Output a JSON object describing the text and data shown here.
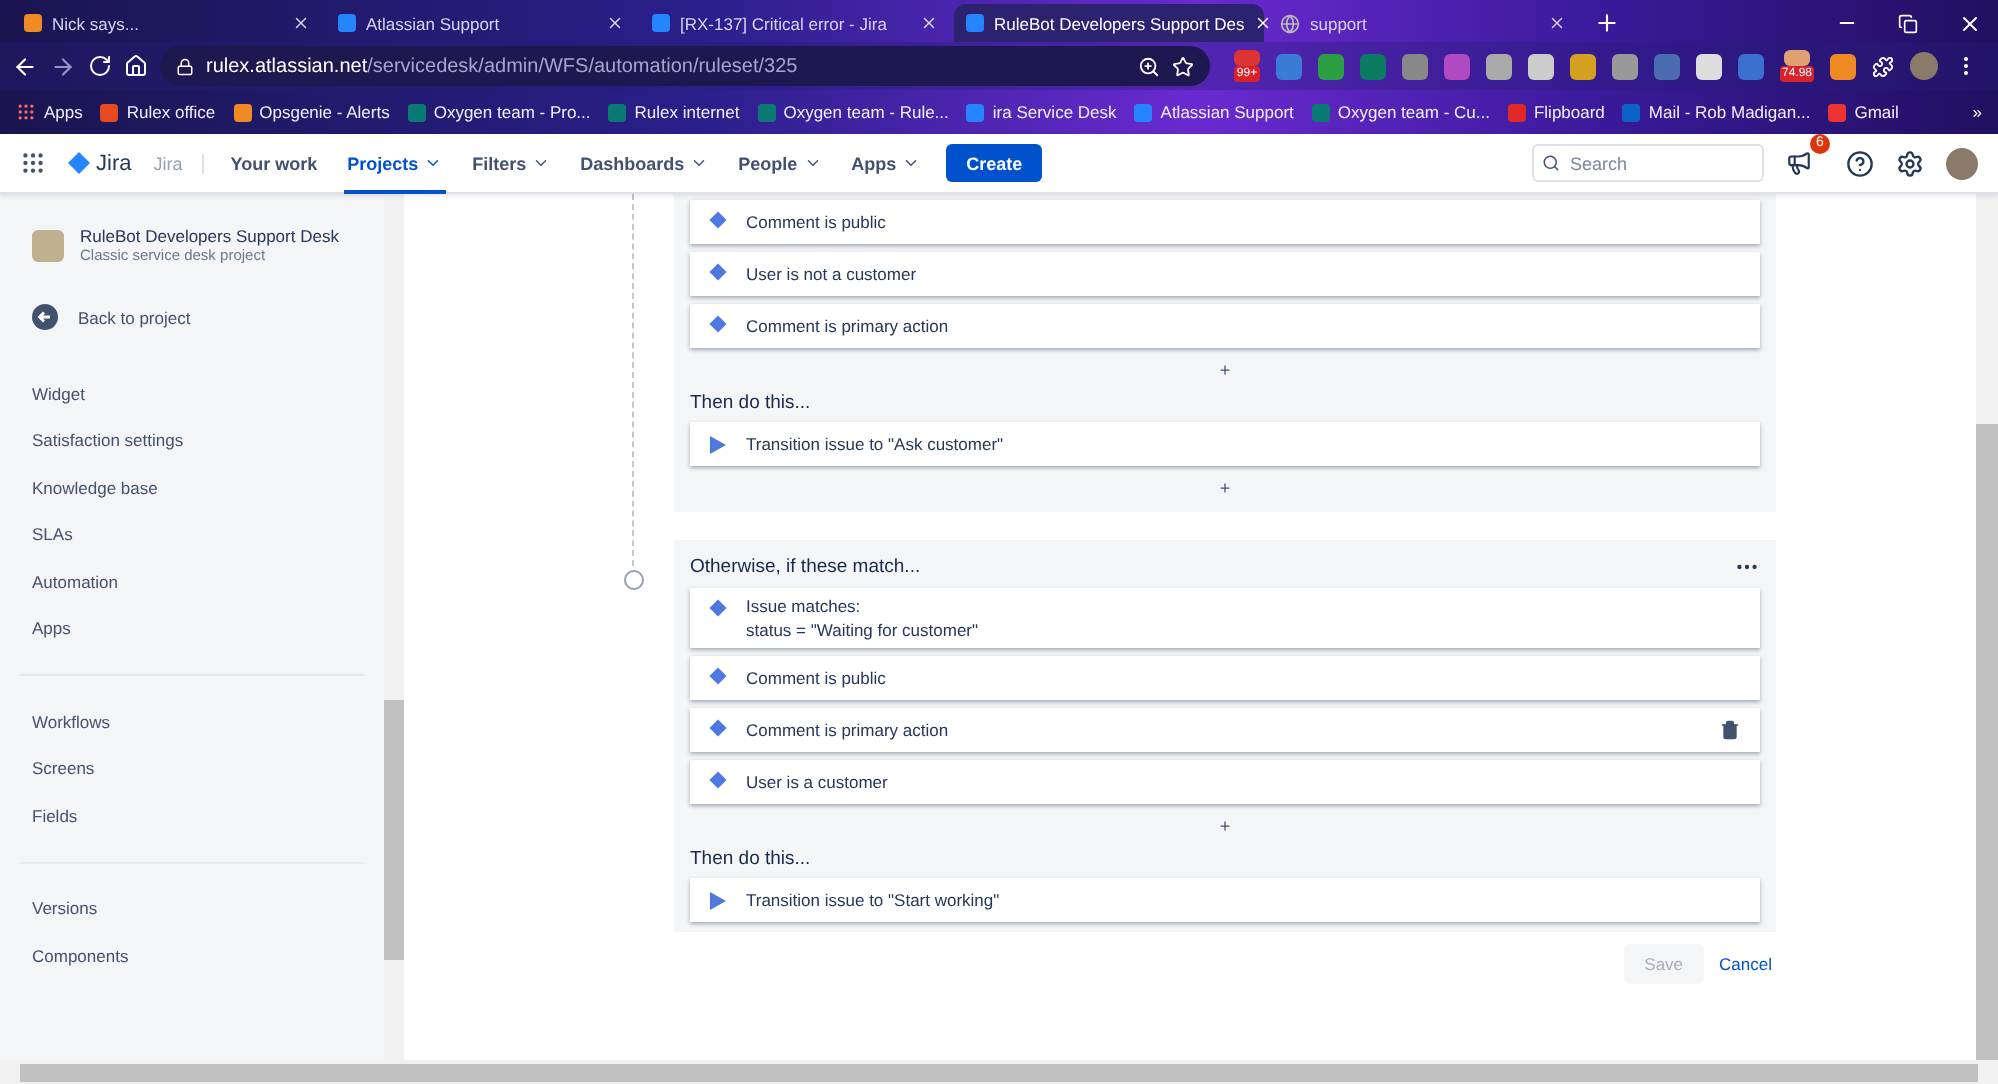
{
  "browser": {
    "tabs": [
      {
        "title": "Nick says...",
        "selected": false
      },
      {
        "title": "Atlassian Support",
        "selected": false
      },
      {
        "title": "[RX-137] Critical error - Jira",
        "selected": false
      },
      {
        "title": "RuleBot Developers Support Des",
        "selected": true
      },
      {
        "title": "support",
        "selected": false
      }
    ],
    "address": {
      "host": "rulex.atlassian.net",
      "path": "/servicedesk/admin/WFS/automation/ruleset/325"
    },
    "extensions": [
      {
        "kind": "badged",
        "badge": "99+"
      },
      {
        "kind": "plain"
      },
      {
        "kind": "plain"
      },
      {
        "kind": "plain"
      },
      {
        "kind": "plain"
      },
      {
        "kind": "plain"
      },
      {
        "kind": "plain"
      },
      {
        "kind": "plain"
      },
      {
        "kind": "plain"
      },
      {
        "kind": "plain"
      },
      {
        "kind": "plain"
      },
      {
        "kind": "plain"
      },
      {
        "kind": "plain"
      },
      {
        "kind": "badged",
        "badge": "74.98"
      },
      {
        "kind": "plain"
      }
    ],
    "bookmarks": [
      "Apps",
      "Rulex office",
      "Opsgenie - Alerts",
      "Oxygen team - Pro...",
      "Rulex internet",
      "Oxygen team - Rule...",
      "ira Service Desk",
      "Atlassian Support",
      "Oxygen team - Cu...",
      "Flipboard",
      "Mail - Rob Madigan...",
      "Gmail"
    ],
    "bookmarks_overflow": "»"
  },
  "jira_nav": {
    "product": "Jira",
    "product_sub": "Jira",
    "items": [
      {
        "label": "Your work",
        "selected": false,
        "dropdown": false
      },
      {
        "label": "Projects",
        "selected": true,
        "dropdown": true
      },
      {
        "label": "Filters",
        "selected": false,
        "dropdown": true
      },
      {
        "label": "Dashboards",
        "selected": false,
        "dropdown": true
      },
      {
        "label": "People",
        "selected": false,
        "dropdown": true
      },
      {
        "label": "Apps",
        "selected": false,
        "dropdown": true
      }
    ],
    "create": "Create",
    "search": {
      "placeholder": "Search"
    },
    "notification_count": "6"
  },
  "sidebar": {
    "project": {
      "name": "RuleBot Developers Support Desk",
      "type": "Classic service desk project"
    },
    "back": "Back to project",
    "groups": [
      [
        "Widget",
        "Satisfaction settings",
        "Knowledge base",
        "SLAs",
        "Automation",
        "Apps"
      ],
      [
        "Workflows",
        "Screens",
        "Fields"
      ],
      [
        "Versions",
        "Components"
      ]
    ]
  },
  "rule": {
    "blocks": [
      {
        "conditions": [
          {
            "text": "Comment is public",
            "hovered": false
          },
          {
            "text": "User is not a customer",
            "hovered": false
          },
          {
            "text": "Comment is primary action",
            "hovered": false
          }
        ],
        "add": "+",
        "then_title": "Then do this...",
        "actions": [
          "Transition issue to \"Ask customer\""
        ],
        "add_after": "+"
      },
      {
        "title": "Otherwise, if these match...",
        "conditions": [
          {
            "text": "Issue matches:",
            "detail": "status = \"Waiting for customer\"",
            "hovered": false
          },
          {
            "text": "Comment is public",
            "hovered": false
          },
          {
            "text": "Comment is primary action",
            "hovered": true
          },
          {
            "text": "User is a customer",
            "hovered": false
          }
        ],
        "add": "+",
        "then_title": "Then do this...",
        "actions": [
          "Transition issue to \"Start working\""
        ]
      }
    ]
  },
  "footer": {
    "save": {
      "label": "Save",
      "disabled": true
    },
    "cancel": "Cancel"
  }
}
